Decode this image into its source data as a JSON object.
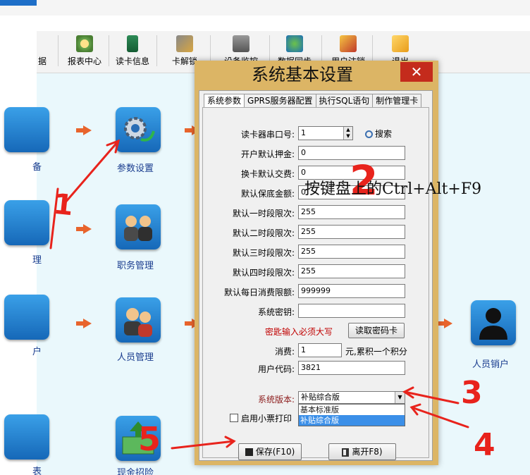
{
  "toolbar": {
    "items": [
      {
        "label": "据",
        "icon": "data-icon"
      },
      {
        "label": "报表中心",
        "icon": "report-center-icon"
      },
      {
        "label": "读卡信息",
        "icon": "card-info-icon"
      },
      {
        "label": "卡解锁",
        "icon": "card-unlock-icon"
      },
      {
        "label": "设备监控",
        "icon": "device-monitor-icon"
      },
      {
        "label": "数据同步",
        "icon": "globe-icon"
      },
      {
        "label": "用户注销",
        "icon": "user-logoff-icon"
      },
      {
        "label": "退出",
        "icon": "exit-icon"
      }
    ]
  },
  "workspace": {
    "tiles": [
      {
        "label": "备"
      },
      {
        "label": "参数设置"
      },
      {
        "label": "理"
      },
      {
        "label": "职务管理"
      },
      {
        "label": "户"
      },
      {
        "label": "人员管理"
      },
      {
        "label": "人员销户"
      },
      {
        "label": "表"
      },
      {
        "label": "现金招险"
      }
    ]
  },
  "dialog": {
    "title": "系统基本设置",
    "close_glyph": "✕",
    "tabs": [
      "系统参数",
      "GPRS服务器配置",
      "执行SQL语句",
      "制作管理卡"
    ],
    "fields": {
      "port_label": "读卡器串口号:",
      "port_value": "1",
      "search_label": "搜索",
      "deposit_label": "开户默认押金:",
      "deposit_value": "0",
      "replace_label": "换卡默认交费:",
      "replace_value": "0",
      "min_label": "默认保底金额:",
      "min_value": "0",
      "p1_label": "默认一时段限次:",
      "p1_value": "255",
      "p2_label": "默认二时段限次:",
      "p2_value": "255",
      "p3_label": "默认三时段限次:",
      "p3_value": "255",
      "p4_label": "默认四时段限次:",
      "p4_value": "255",
      "daily_label": "默认每日消费限额:",
      "daily_value": "999999",
      "key_label": "系统密钥:",
      "key_value": "",
      "key_hint": "密匙输入必须大写",
      "read_key_button": "读取密码卡",
      "spend_label": "消费:",
      "spend_value": "1",
      "spend_suffix": "元,累积一个积分",
      "usercode_label": "用户代码:",
      "usercode_value": "3821",
      "version_label": "系统版本:",
      "version_value": "补贴综合版",
      "version_options": [
        "基本标准版",
        "补贴综合版"
      ],
      "receipt_label": "启用小票打印"
    },
    "buttons": {
      "save": "保存(F10)",
      "leave": "离开F8)"
    }
  },
  "annotations": {
    "overlay_text": "按键盘上的Ctrl+Alt+F9",
    "step1": "1",
    "step2": "2",
    "step3": "3",
    "step4": "4",
    "step5": "5",
    "color": "#e8231c"
  }
}
